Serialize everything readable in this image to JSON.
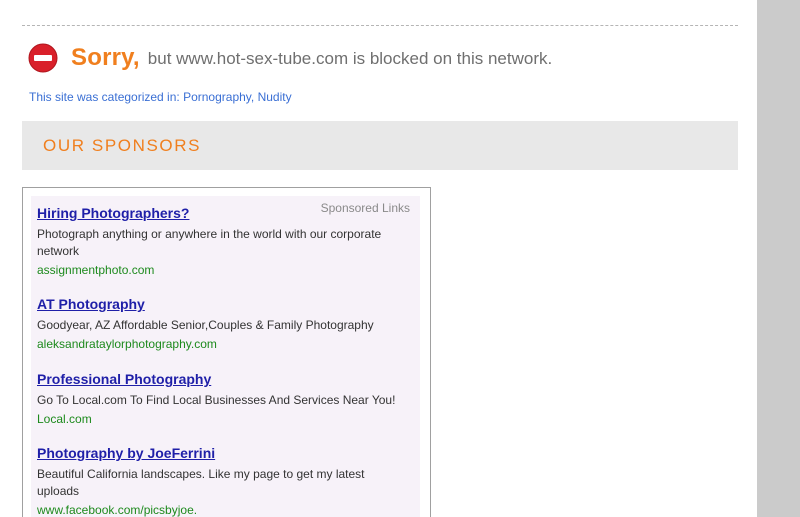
{
  "block_notice": {
    "sorry": "Sorry,",
    "message": "but www.hot-sex-tube.com is blocked on this network."
  },
  "category": {
    "prefix": "This site was categorized in:",
    "categories": [
      "Pornography",
      "Nudity"
    ]
  },
  "sponsors": {
    "title": "OUR SPONSORS",
    "sponsored_label": "Sponsored Links",
    "ads": [
      {
        "title": "Hiring Photographers?",
        "description": "Photograph anything or anywhere in the world with our corporate network",
        "url": "assignmentphoto.com"
      },
      {
        "title": "AT Photography",
        "description": "Goodyear, AZ Affordable Senior,Couples & Family Photography",
        "url": "aleksandrataylorphotography.com"
      },
      {
        "title": "Professional Photography",
        "description": "Go To Local.com To Find Local Businesses And Services Near You!",
        "url": "Local.com"
      },
      {
        "title": "Photography by JoeFerrini",
        "description": "Beautiful California landscapes. Like my page to get my latest uploads",
        "url": "www.facebook.com/picsbyjoe."
      }
    ]
  },
  "colors": {
    "accent_orange": "#f07f1e",
    "link_blue": "#3a6fd4",
    "ad_title_blue": "#1f1fa8",
    "ad_url_green": "#1d8a1d",
    "stop_icon_red": "#d9202a"
  },
  "icons": {
    "blocked": "no-entry-icon"
  }
}
